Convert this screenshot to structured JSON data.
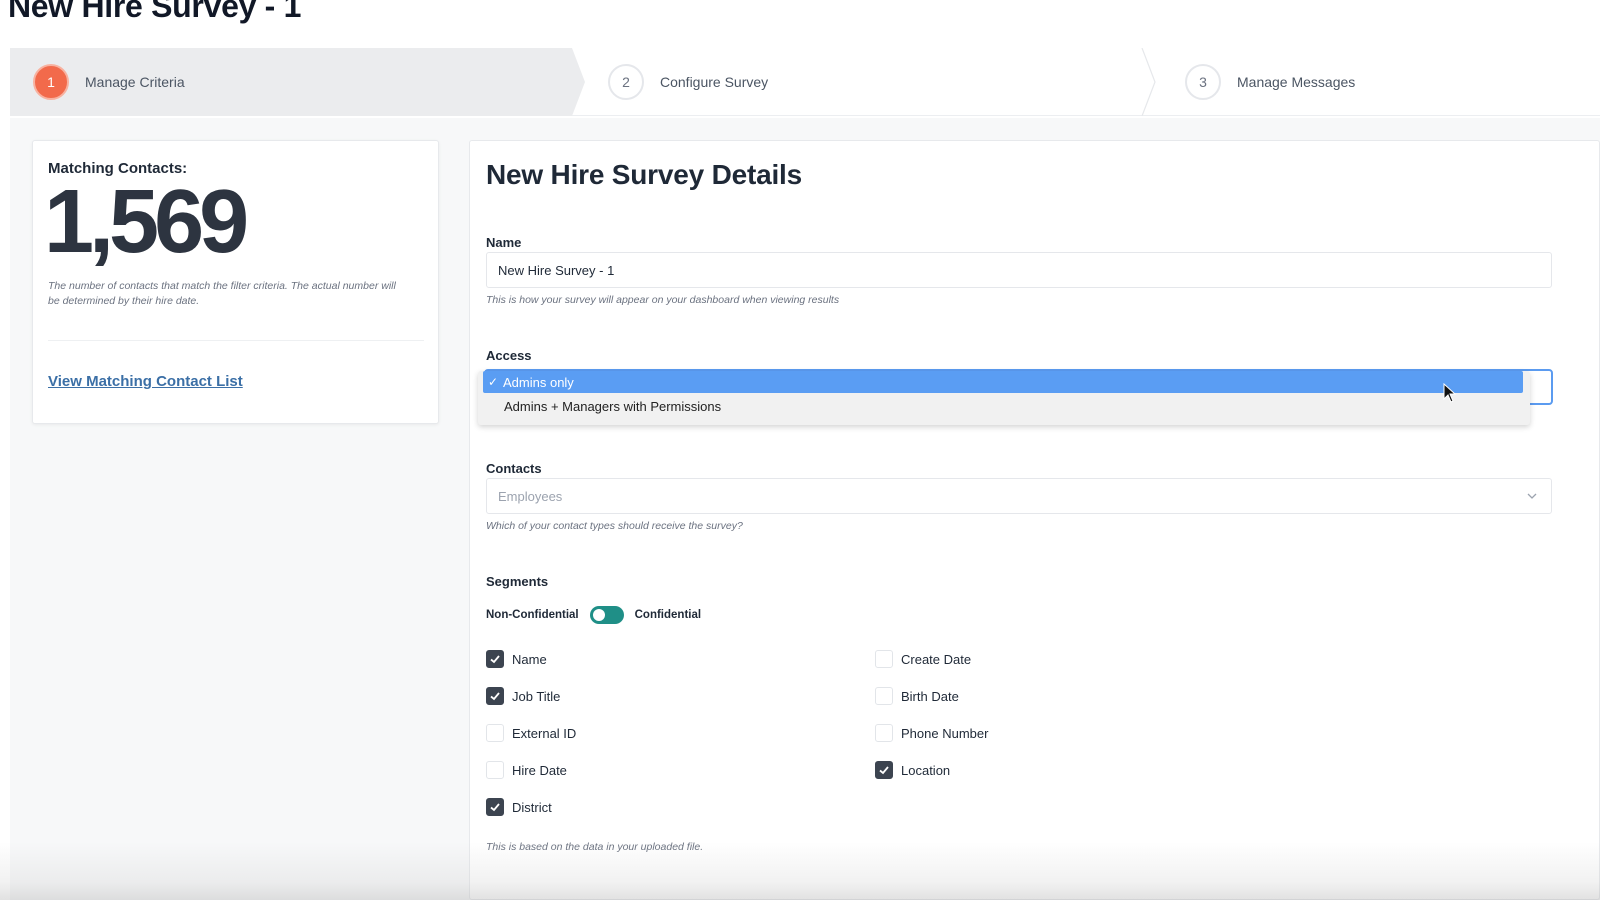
{
  "page": {
    "title": "New Hire Survey - 1"
  },
  "stepper": {
    "steps": [
      {
        "number": "1",
        "label": "Manage Criteria"
      },
      {
        "number": "2",
        "label": "Configure Survey"
      },
      {
        "number": "3",
        "label": "Manage Messages"
      }
    ]
  },
  "matching": {
    "label": "Matching Contacts:",
    "count": "1,569",
    "note": "The number of contacts that match the filter criteria. The actual number will be determined by their hire date.",
    "link": "View Matching Contact List"
  },
  "details": {
    "title": "New Hire Survey Details",
    "name": {
      "label": "Name",
      "value": "New Hire Survey - 1",
      "help": "This is how your survey will appear on your dashboard when viewing results"
    },
    "access": {
      "label": "Access",
      "options": [
        "Admins only",
        "Admins + Managers with Permissions"
      ],
      "selected": "Admins only"
    },
    "contacts": {
      "label": "Contacts",
      "value": "Employees",
      "help": "Which of your contact types should receive the survey?"
    },
    "segments": {
      "label": "Segments",
      "toggle_left": "Non-Confidential",
      "toggle_right": "Confidential",
      "items": [
        {
          "label": "Name",
          "checked": true
        },
        {
          "label": "Job Title",
          "checked": true
        },
        {
          "label": "External ID",
          "checked": false
        },
        {
          "label": "Hire Date",
          "checked": false
        },
        {
          "label": "District",
          "checked": true
        },
        {
          "label": "Create Date",
          "checked": false
        },
        {
          "label": "Birth Date",
          "checked": false
        },
        {
          "label": "Phone Number",
          "checked": false
        },
        {
          "label": "Location",
          "checked": true
        }
      ],
      "help": "This is based on the data in your uploaded file."
    }
  },
  "colors": {
    "accent": "#f26a4b",
    "link": "#3b6fa6",
    "select_highlight": "#5a9df3",
    "toggle": "#1f8f87",
    "checkbox_checked": "#3c4450"
  }
}
